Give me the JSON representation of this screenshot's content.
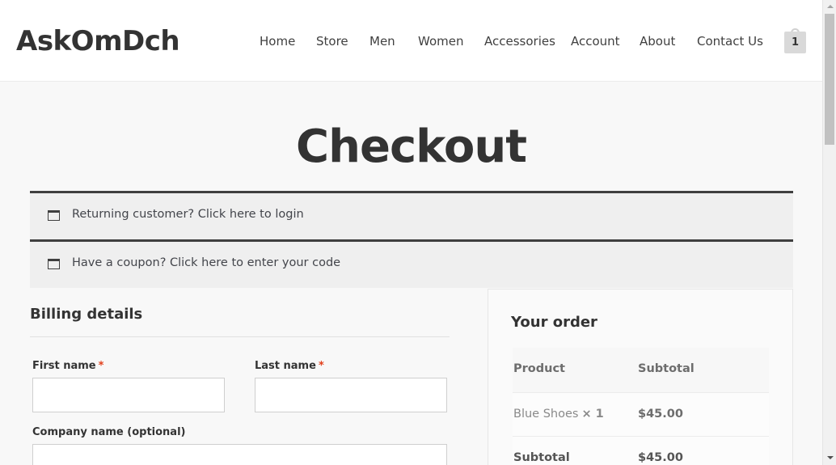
{
  "site": {
    "logo": "AskOmDch"
  },
  "nav": [
    {
      "label": "Home"
    },
    {
      "label": "Store"
    },
    {
      "label": "Men"
    },
    {
      "label": "Women"
    },
    {
      "label": "Accessories"
    },
    {
      "label": "Account"
    },
    {
      "label": "About"
    },
    {
      "label": "Contact Us"
    }
  ],
  "cart": {
    "count": "1"
  },
  "page": {
    "title": "Checkout"
  },
  "notices": {
    "returning": "Returning customer? Click here to login",
    "coupon": "Have a coupon? Click here to enter your code"
  },
  "billing": {
    "heading": "Billing details",
    "first_name_label": "First name",
    "last_name_label": "Last name",
    "company_label": "Company name (optional)",
    "required_mark": "*"
  },
  "order": {
    "heading": "Your order",
    "col_product": "Product",
    "col_subtotal": "Subtotal",
    "items": [
      {
        "name": "Blue Shoes",
        "qty": "× 1",
        "subtotal": "$45.00"
      }
    ],
    "subtotal_label": "Subtotal",
    "subtotal_value": "$45.00"
  }
}
